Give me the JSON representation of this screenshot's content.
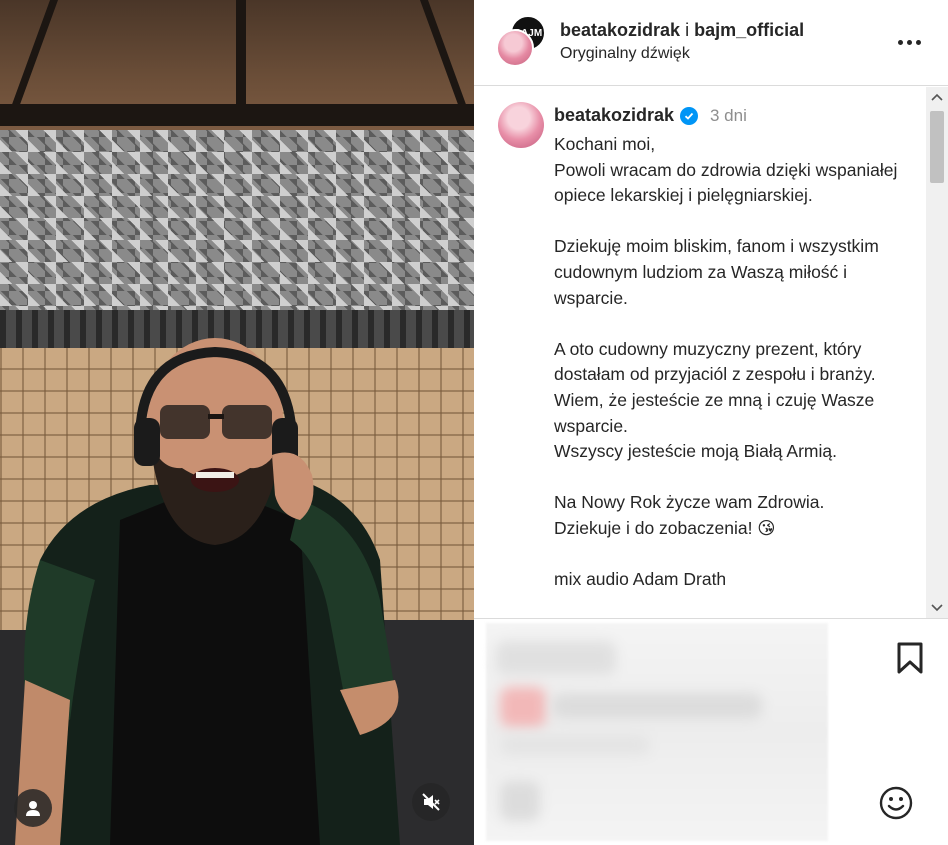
{
  "header": {
    "username_primary": "beatakozidrak",
    "connector": " i ",
    "username_secondary": "bajm_official",
    "audio_label": "Oryginalny dźwięk"
  },
  "caption": {
    "username": "beatakozidrak",
    "time": "3 dni",
    "text": "Kochani moi,\nPowoli wracam do zdrowia dzięki wspaniałej opiece lekarskiej i pielęgniarskiej.\n\nDziekuję moim bliskim, fanom i wszystkim cudownym ludziom za Waszą miłość i wsparcie.\n\nA oto cudowny muzyczny prezent, który dostałam od przyjaciól z zespołu i branży. Wiem, że jesteście ze mną i czuję Wasze wsparcie.\nWszyscy jesteście moją Białą Armią.\n\nNa Nowy Rok życze wam Zdrowia.\nDziekuje i do zobaczenia! 😘\n\nmix audio Adam Drath"
  },
  "icons": {
    "avatar_left": "user-icon",
    "mute": "muted-speaker-icon",
    "more": "more-dots-icon",
    "verified": "verified-badge-icon",
    "bookmark": "bookmark-icon",
    "emoji": "emoji-smile-icon",
    "scroll_up": "chevron-up-icon",
    "scroll_down": "chevron-down-icon"
  },
  "colors": {
    "verified": "#0095f6",
    "text": "#262626",
    "muted_text": "#8e8e8e",
    "divider": "#dbdbdb"
  }
}
